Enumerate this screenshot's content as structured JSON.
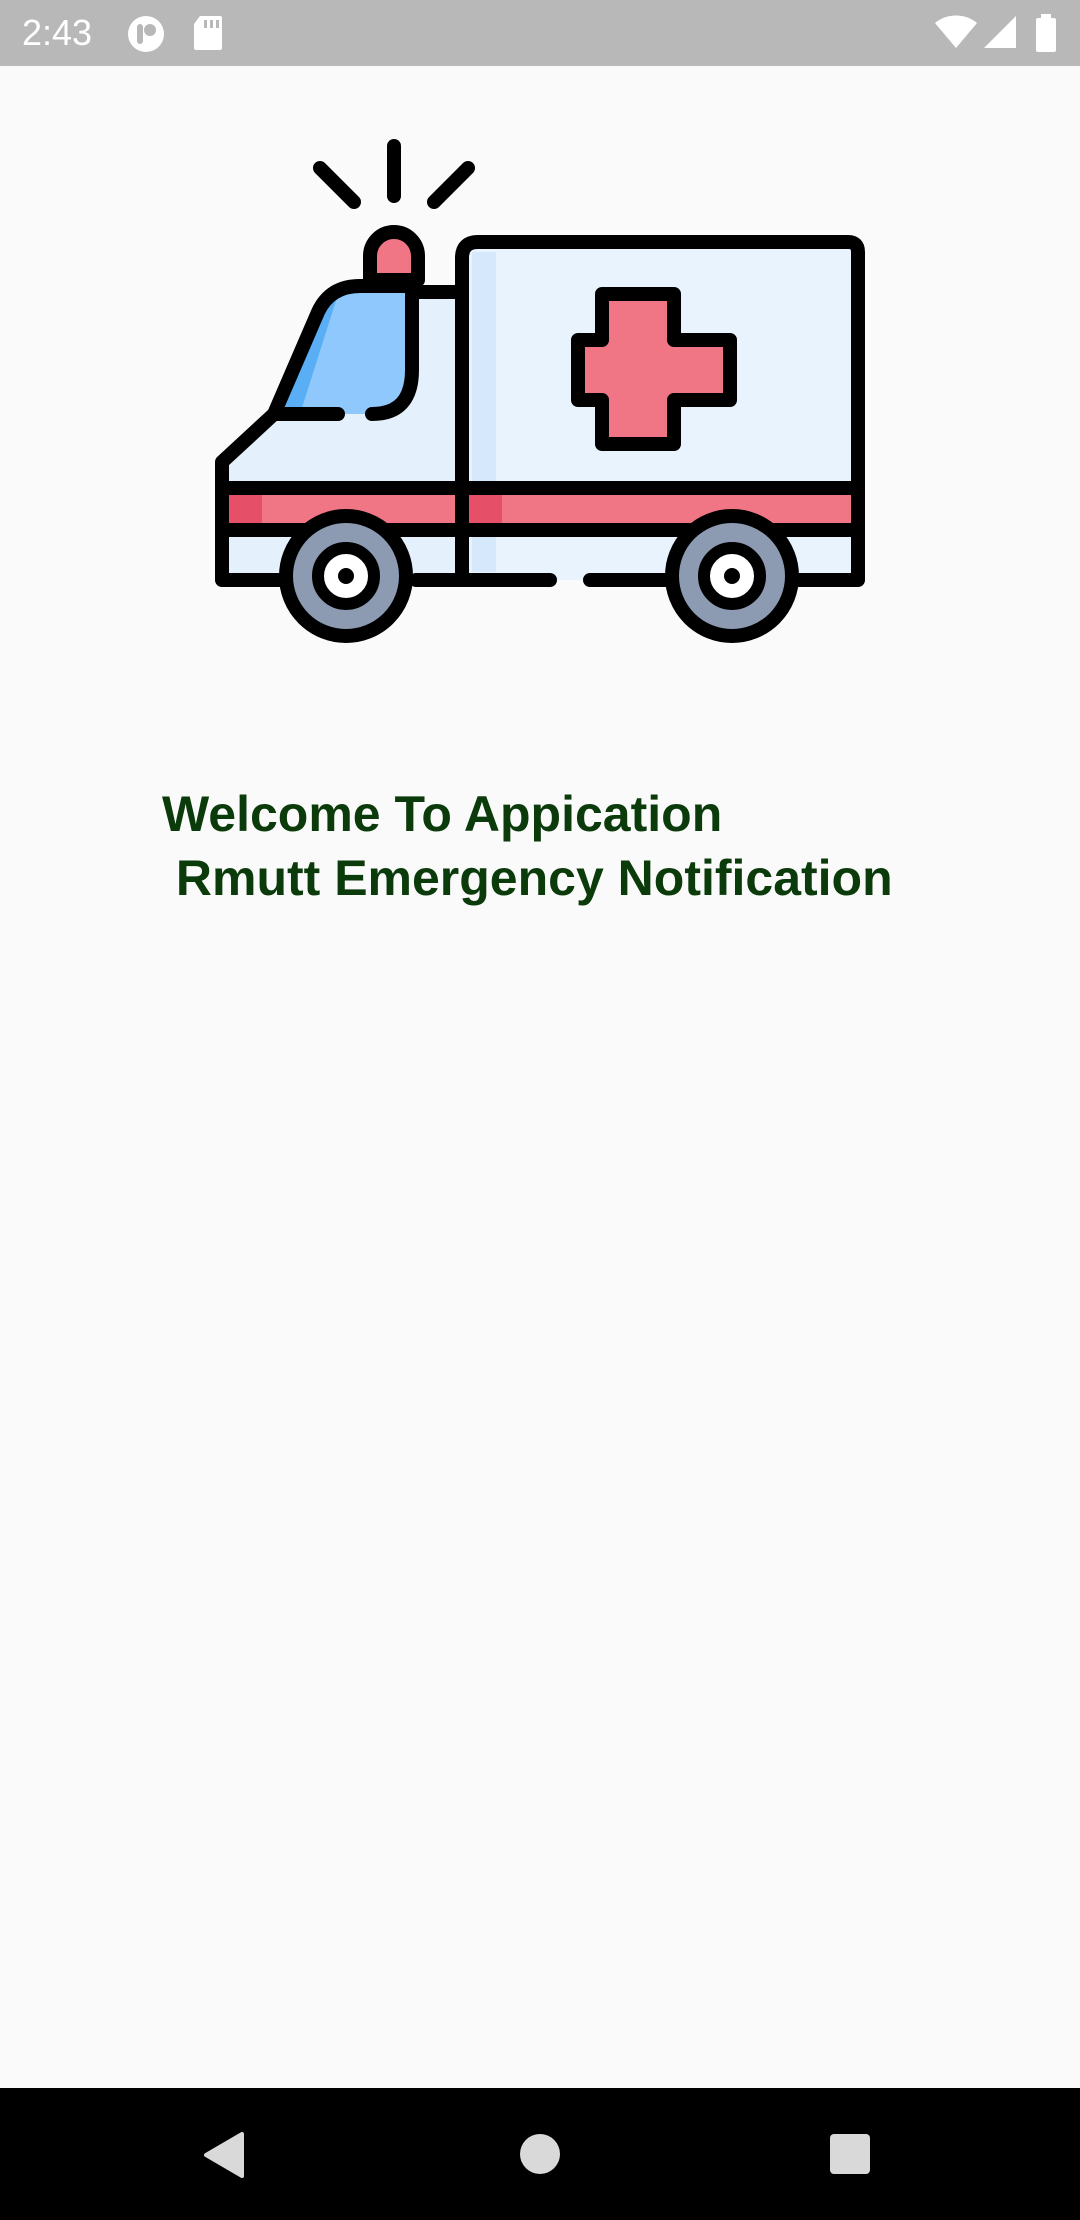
{
  "status_bar": {
    "time": "2:43",
    "left_icons": [
      "app-notification-icon",
      "sd-card-icon"
    ],
    "right_icons": [
      "wifi-icon",
      "cellular-signal-icon",
      "battery-icon"
    ]
  },
  "main": {
    "hero_icon": "ambulance-icon",
    "welcome_line1": "Welcome To Appication",
    "welcome_line2": " Rmutt Emergency Notification",
    "text_color": "#0b3a0b"
  },
  "nav_bar": {
    "buttons": [
      "back-icon",
      "home-icon",
      "recents-icon"
    ]
  }
}
